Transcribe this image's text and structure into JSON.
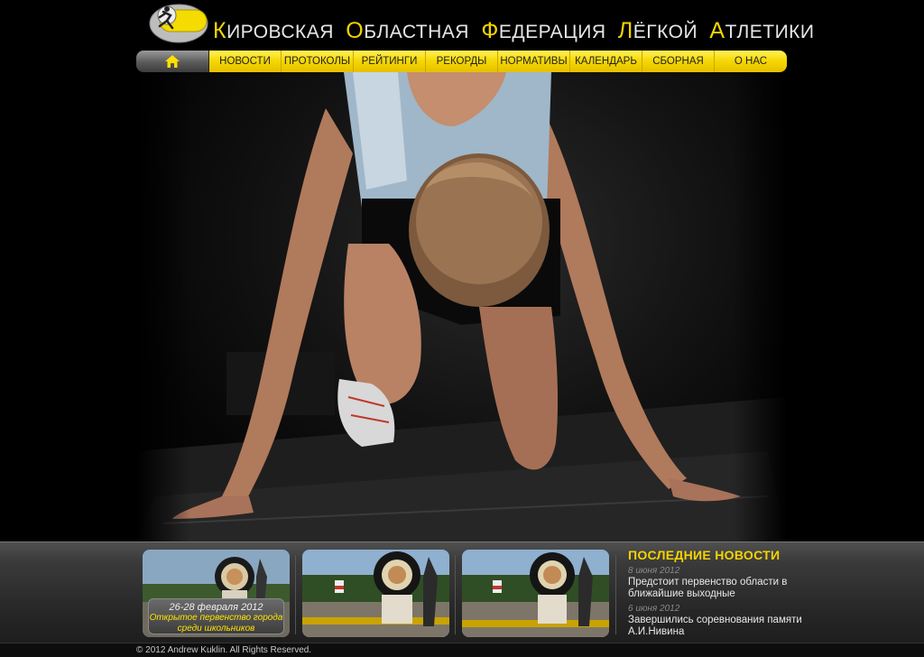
{
  "header": {
    "title_words": [
      {
        "cap": "К",
        "rest": "ИРОВСКАЯ"
      },
      {
        "cap": "О",
        "rest": "БЛАСТНАЯ"
      },
      {
        "cap": "Ф",
        "rest": "ЕДЕРАЦИЯ"
      },
      {
        "cap": "Л",
        "rest": "ЁГКОЙ"
      },
      {
        "cap": "А",
        "rest": "ТЛЕТИКИ"
      }
    ],
    "logo_icon": "running-athlete-logo"
  },
  "nav": {
    "home_icon": "home-icon",
    "items": [
      {
        "label": "НОВОСТИ"
      },
      {
        "label": "ПРОТОКОЛЫ"
      },
      {
        "label": "РЕЙТИНГИ"
      },
      {
        "label": "РЕКОРДЫ"
      },
      {
        "label": "НОРМАТИВЫ"
      },
      {
        "label": "КАЛЕНДАРЬ"
      },
      {
        "label": "СБОРНАЯ"
      },
      {
        "label": "О НАС"
      }
    ]
  },
  "hero": {
    "image": "sprinter-in-starting-position"
  },
  "thumbnails": [
    {
      "date": "26-28 февраля 2012",
      "title_line1": "Открытое первенство города",
      "title_line2": "среди школьников"
    },
    {
      "date": "",
      "title_line1": "",
      "title_line2": ""
    },
    {
      "date": "",
      "title_line1": "",
      "title_line2": ""
    }
  ],
  "news": {
    "header": "ПОСЛЕДНИЕ НОВОСТИ",
    "items": [
      {
        "date": "8 июня 2012",
        "text": "Предстоит первенство области в ближайшие выходные"
      },
      {
        "date": "6 июня 2012",
        "text": "Завершились соревнования памяти А.И.Нивина"
      }
    ]
  },
  "footer": {
    "copyright": "© 2012 Andrew Kuklin. All Rights Reserved."
  },
  "colors": {
    "accent_yellow": "#f3d400",
    "background": "#000000",
    "panel_gray": "#3a3a3a"
  }
}
